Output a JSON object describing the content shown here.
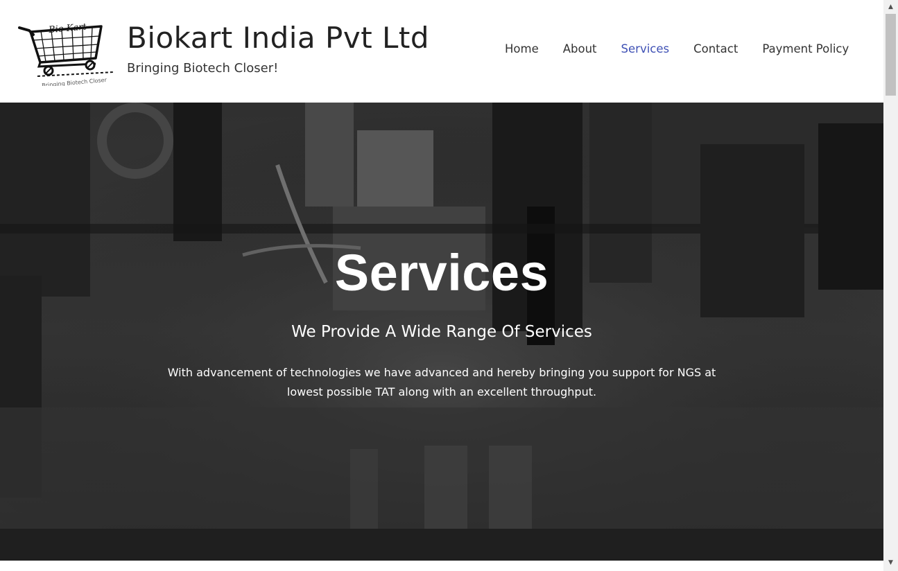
{
  "header": {
    "logo_text": "Bio Kart",
    "logo_caption": "Bringing Biotech Closer",
    "site_title": "Biokart India Pvt Ltd",
    "tagline": "Bringing Biotech Closer!"
  },
  "nav": {
    "items": [
      {
        "label": "Home"
      },
      {
        "label": "About"
      },
      {
        "label": "Services"
      },
      {
        "label": "Contact"
      },
      {
        "label": "Payment Policy"
      }
    ],
    "active": "Services"
  },
  "hero": {
    "title": "Services",
    "subtitle": "We Provide A Wide Range Of Services",
    "text": "With advancement of technologies we have advanced and hereby bringing you support for NGS at lowest possible TAT along with an excellent throughput."
  },
  "colors": {
    "nav_active": "#3f51b5",
    "text_dark": "#222222",
    "hero_overlay": "#2f2f2f"
  },
  "icons": {
    "logo": "shopping-cart-icon",
    "scroll_up": "arrow-up-icon",
    "scroll_down": "arrow-down-icon"
  }
}
